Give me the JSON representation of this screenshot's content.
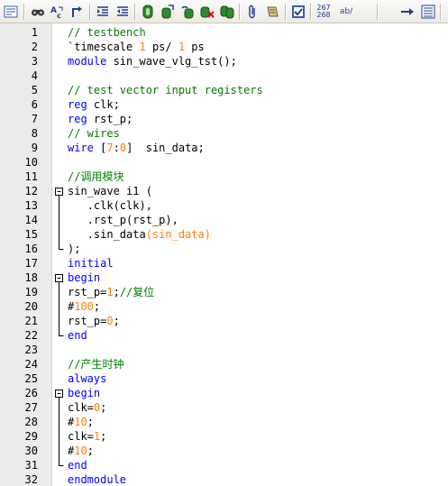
{
  "toolbar": {
    "items": [
      {
        "name": "show-all-chars-icon"
      },
      {
        "name": "find-icon"
      },
      {
        "name": "replace-icon"
      },
      {
        "name": "goto-icon"
      },
      {
        "name": "indent-icon"
      },
      {
        "name": "unindent-icon"
      },
      {
        "name": "record-macro-icon"
      },
      {
        "name": "stop-macro-icon"
      },
      {
        "name": "play-macro-icon"
      },
      {
        "name": "clear-macro-icon"
      },
      {
        "name": "run-macro-multiple-icon"
      },
      {
        "name": "attach-icon"
      },
      {
        "name": "scroll-icon"
      },
      {
        "name": "checklist-icon"
      },
      {
        "name": "wrap-icon"
      },
      {
        "name": "next-icon"
      },
      {
        "name": "panel-icon"
      }
    ],
    "number_label_top": "267",
    "number_label_bottom": "268",
    "ab_label": "ab/"
  },
  "editor": {
    "lines": [
      {
        "n": "1",
        "fold": "none",
        "tokens": [
          {
            "t": "// testbench",
            "c": "comment"
          }
        ]
      },
      {
        "n": "2",
        "fold": "none",
        "tokens": [
          {
            "t": "`timescale ",
            "c": "normal"
          },
          {
            "t": "1",
            "c": "num"
          },
          {
            "t": " ps/ ",
            "c": "normal"
          },
          {
            "t": "1",
            "c": "num"
          },
          {
            "t": " ps",
            "c": "normal"
          }
        ]
      },
      {
        "n": "3",
        "fold": "none",
        "tokens": [
          {
            "t": "module",
            "c": "kw"
          },
          {
            "t": " sin_wave_vlg_tst();",
            "c": "normal"
          }
        ]
      },
      {
        "n": "4",
        "fold": "none",
        "tokens": []
      },
      {
        "n": "5",
        "fold": "none",
        "tokens": [
          {
            "t": "// test vector input registers",
            "c": "comment"
          }
        ]
      },
      {
        "n": "6",
        "fold": "none",
        "tokens": [
          {
            "t": "reg",
            "c": "kw"
          },
          {
            "t": " clk;",
            "c": "normal"
          }
        ]
      },
      {
        "n": "7",
        "fold": "none",
        "tokens": [
          {
            "t": "reg",
            "c": "kw"
          },
          {
            "t": " rst_p;",
            "c": "normal"
          }
        ]
      },
      {
        "n": "8",
        "fold": "none",
        "tokens": [
          {
            "t": "// wires",
            "c": "comment"
          }
        ]
      },
      {
        "n": "9",
        "fold": "none",
        "tokens": [
          {
            "t": "wire",
            "c": "kw"
          },
          {
            "t": " [",
            "c": "normal"
          },
          {
            "t": "7",
            "c": "num"
          },
          {
            "t": ":",
            "c": "normal"
          },
          {
            "t": "0",
            "c": "num"
          },
          {
            "t": "]  sin_data;",
            "c": "normal"
          }
        ]
      },
      {
        "n": "10",
        "fold": "none",
        "tokens": []
      },
      {
        "n": "11",
        "fold": "none",
        "tokens": [
          {
            "t": "//调用模块",
            "c": "comment"
          }
        ]
      },
      {
        "n": "12",
        "fold": "start",
        "tokens": [
          {
            "t": "sin_wave i1 (",
            "c": "normal"
          }
        ]
      },
      {
        "n": "13",
        "fold": "line",
        "tokens": [
          {
            "t": "   .clk(clk),",
            "c": "normal"
          }
        ]
      },
      {
        "n": "14",
        "fold": "line",
        "tokens": [
          {
            "t": "   .rst_p(rst_p),",
            "c": "normal"
          }
        ]
      },
      {
        "n": "15",
        "fold": "line",
        "tokens": [
          {
            "t": "   .sin_data",
            "c": "normal"
          },
          {
            "t": "(sin_data)",
            "c": "num"
          }
        ]
      },
      {
        "n": "16",
        "fold": "end",
        "tokens": [
          {
            "t": ");",
            "c": "normal"
          }
        ]
      },
      {
        "n": "17",
        "fold": "none",
        "tokens": [
          {
            "t": "initial",
            "c": "kw"
          }
        ]
      },
      {
        "n": "18",
        "fold": "start",
        "tokens": [
          {
            "t": "begin",
            "c": "kw"
          }
        ]
      },
      {
        "n": "19",
        "fold": "line",
        "tokens": [
          {
            "t": "rst_p=",
            "c": "normal"
          },
          {
            "t": "1",
            "c": "num"
          },
          {
            "t": ";",
            "c": "normal"
          },
          {
            "t": "//复位",
            "c": "comment"
          }
        ]
      },
      {
        "n": "20",
        "fold": "line",
        "tokens": [
          {
            "t": "#",
            "c": "normal"
          },
          {
            "t": "100",
            "c": "num"
          },
          {
            "t": ";",
            "c": "normal"
          }
        ]
      },
      {
        "n": "21",
        "fold": "line",
        "tokens": [
          {
            "t": "rst_p=",
            "c": "normal"
          },
          {
            "t": "0",
            "c": "num"
          },
          {
            "t": ";",
            "c": "normal"
          }
        ]
      },
      {
        "n": "22",
        "fold": "end",
        "tokens": [
          {
            "t": "end",
            "c": "kw"
          }
        ]
      },
      {
        "n": "23",
        "fold": "none",
        "tokens": []
      },
      {
        "n": "24",
        "fold": "none",
        "tokens": [
          {
            "t": "//产生时钟",
            "c": "comment"
          }
        ]
      },
      {
        "n": "25",
        "fold": "none",
        "tokens": [
          {
            "t": "always",
            "c": "kw"
          }
        ]
      },
      {
        "n": "26",
        "fold": "start",
        "tokens": [
          {
            "t": "begin",
            "c": "kw"
          }
        ]
      },
      {
        "n": "27",
        "fold": "line",
        "tokens": [
          {
            "t": "clk=",
            "c": "normal"
          },
          {
            "t": "0",
            "c": "num"
          },
          {
            "t": ";",
            "c": "normal"
          }
        ]
      },
      {
        "n": "28",
        "fold": "line",
        "tokens": [
          {
            "t": "#",
            "c": "normal"
          },
          {
            "t": "10",
            "c": "num"
          },
          {
            "t": ";",
            "c": "normal"
          }
        ]
      },
      {
        "n": "29",
        "fold": "line",
        "tokens": [
          {
            "t": "clk=",
            "c": "normal"
          },
          {
            "t": "1",
            "c": "num"
          },
          {
            "t": ";",
            "c": "normal"
          }
        ]
      },
      {
        "n": "30",
        "fold": "line",
        "tokens": [
          {
            "t": "#",
            "c": "normal"
          },
          {
            "t": "10",
            "c": "num"
          },
          {
            "t": ";",
            "c": "normal"
          }
        ]
      },
      {
        "n": "31",
        "fold": "end",
        "tokens": [
          {
            "t": "end",
            "c": "kw"
          }
        ]
      },
      {
        "n": "32",
        "fold": "none",
        "tokens": [
          {
            "t": "endmodule",
            "c": "kw"
          }
        ]
      }
    ]
  },
  "colors": {
    "comment": "#008000",
    "keyword": "#0000ff",
    "number": "#ff8000",
    "gutter": "#ebebeb"
  }
}
